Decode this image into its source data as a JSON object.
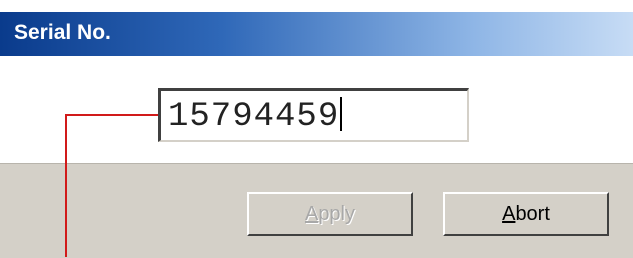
{
  "window": {
    "title": "Serial No."
  },
  "serial": {
    "value": "15794459"
  },
  "buttons": {
    "apply": {
      "mnemonic": "A",
      "rest": "pply",
      "enabled": false
    },
    "abort": {
      "mnemonic": "A",
      "rest": "bort",
      "enabled": true
    }
  },
  "colors": {
    "titlebar_start": "#0a3b8c",
    "titlebar_end": "#c7dcf5",
    "button_face": "#d4d0c8",
    "callout_line": "#d11a1a"
  }
}
